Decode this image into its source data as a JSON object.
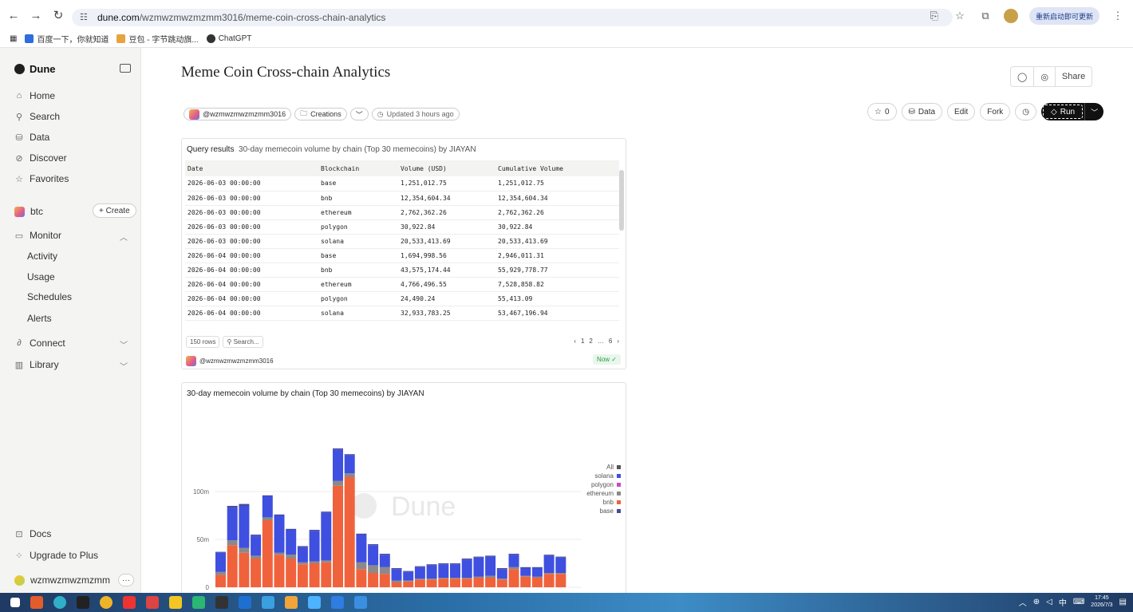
{
  "browser": {
    "url_host": "dune.com",
    "url_path": "/wzmwzmwzmzmm3016/meme-coin-cross-chain-analytics",
    "update_label": "重新启动即可更新",
    "bookmarks": [
      "百度一下，你就知道",
      "豆包 - 字节跳动旗...",
      "ChatGPT"
    ]
  },
  "sidebar": {
    "brand": "Dune",
    "nav": [
      {
        "label": "Home",
        "icon": "home-icon",
        "glyph": "⌂"
      },
      {
        "label": "Search",
        "icon": "search-icon",
        "glyph": "⚲"
      },
      {
        "label": "Data",
        "icon": "database-icon",
        "glyph": "⛁"
      },
      {
        "label": "Discover",
        "icon": "compass-icon",
        "glyph": "⊘"
      },
      {
        "label": "Favorites",
        "icon": "star-icon",
        "glyph": "☆"
      }
    ],
    "team": "btc",
    "create_label": "+ Create",
    "monitor": "Monitor",
    "monitor_items": [
      "Activity",
      "Usage",
      "Schedules",
      "Alerts"
    ],
    "connect": "Connect",
    "library": "Library",
    "docs": "Docs",
    "upgrade": "Upgrade to Plus",
    "user": "wzmwzmwzmzmm"
  },
  "header": {
    "title": "Meme Coin Cross-chain Analytics",
    "share_label": "Share",
    "author": "@wzmwzmwzmzmm3016",
    "collection": "Creations",
    "updated": "Updated 3 hours ago",
    "stars": "0",
    "data_label": "Data",
    "edit_label": "Edit",
    "fork_label": "Fork",
    "run_label": "Run"
  },
  "results": {
    "title": "Query results",
    "subtitle": "30-day memecoin volume by chain (Top 30 memecoins) by JIAYAN",
    "columns": [
      "Date",
      "Blockchain",
      "Volume (USD)",
      "Cumulative Volume"
    ],
    "rows": [
      [
        "2026-06-03 00:00:00",
        "base",
        "1,251,012.75",
        "1,251,012.75"
      ],
      [
        "2026-06-03 00:00:00",
        "bnb",
        "12,354,604.34",
        "12,354,604.34"
      ],
      [
        "2026-06-03 00:00:00",
        "ethereum",
        "2,762,362.26",
        "2,762,362.26"
      ],
      [
        "2026-06-03 00:00:00",
        "polygon",
        "30,922.84",
        "30,922.84"
      ],
      [
        "2026-06-03 00:00:00",
        "solana",
        "20,533,413.69",
        "20,533,413.69"
      ],
      [
        "2026-06-04 00:00:00",
        "base",
        "1,694,998.56",
        "2,946,011.31"
      ],
      [
        "2026-06-04 00:00:00",
        "bnb",
        "43,575,174.44",
        "55,929,778.77"
      ],
      [
        "2026-06-04 00:00:00",
        "ethereum",
        "4,766,496.55",
        "7,528,858.82"
      ],
      [
        "2026-06-04 00:00:00",
        "polygon",
        "24,490.24",
        "55,413.09"
      ],
      [
        "2026-06-04 00:00:00",
        "solana",
        "32,933,783.25",
        "53,467,196.94"
      ]
    ],
    "row_count": "150 rows",
    "search_placeholder": "Search...",
    "pager": [
      "‹",
      "1",
      "2",
      "…",
      "6",
      "›"
    ],
    "author": "@wzmwzmwzmzmm3016",
    "status": "Now"
  },
  "chart_data": {
    "type": "bar",
    "title": "30-day memecoin volume by chain (Top 30 memecoins) by JIAYAN",
    "y_ticks": [
      "0",
      "50m",
      "100m"
    ],
    "ylim": [
      0,
      150
    ],
    "watermark": "Dune",
    "legend_position": "right",
    "legend": [
      {
        "name": "All",
        "color": "#555555"
      },
      {
        "name": "solana",
        "color": "#3f4fe0"
      },
      {
        "name": "polygon",
        "color": "#c54bc8"
      },
      {
        "name": "ethereum",
        "color": "#8a8a8a"
      },
      {
        "name": "bnb",
        "color": "#f0623c"
      },
      {
        "name": "base",
        "color": "#4a4a9a"
      }
    ],
    "series": [
      {
        "name": "bnb",
        "color": "#f0623c",
        "values": [
          13,
          44,
          36,
          30,
          70,
          34,
          30,
          24,
          25,
          26,
          106,
          115,
          19,
          15,
          14,
          5,
          6,
          8,
          8,
          9,
          9,
          9,
          10,
          10,
          8,
          19,
          11,
          10,
          14,
          14
        ]
      },
      {
        "name": "ethereum",
        "color": "#8a8a8a",
        "values": [
          3,
          5,
          5,
          3,
          3,
          2,
          4,
          2,
          2,
          2,
          5,
          4,
          7,
          8,
          7,
          2,
          1,
          1,
          1,
          1,
          1,
          1,
          1,
          2,
          1,
          2,
          1,
          1,
          1,
          1
        ]
      },
      {
        "name": "solana",
        "color": "#3f4fe0",
        "values": [
          20,
          34,
          44,
          21,
          22,
          39,
          26,
          16,
          32,
          50,
          33,
          19,
          29,
          21,
          13,
          12,
          9,
          12,
          14,
          14,
          14,
          19,
          20,
          20,
          10,
          13,
          8,
          9,
          18,
          16
        ]
      },
      {
        "name": "base",
        "color": "#4a4a9a",
        "values": [
          1,
          2,
          2,
          1,
          1,
          1,
          1,
          1,
          1,
          1,
          1,
          1,
          1,
          1,
          1,
          1,
          1,
          1,
          1,
          1,
          1,
          1,
          1,
          1,
          1,
          1,
          1,
          1,
          1,
          1
        ]
      }
    ]
  },
  "taskbar": {
    "time": "17:45",
    "date": "2026/7/3",
    "ime": "中"
  }
}
